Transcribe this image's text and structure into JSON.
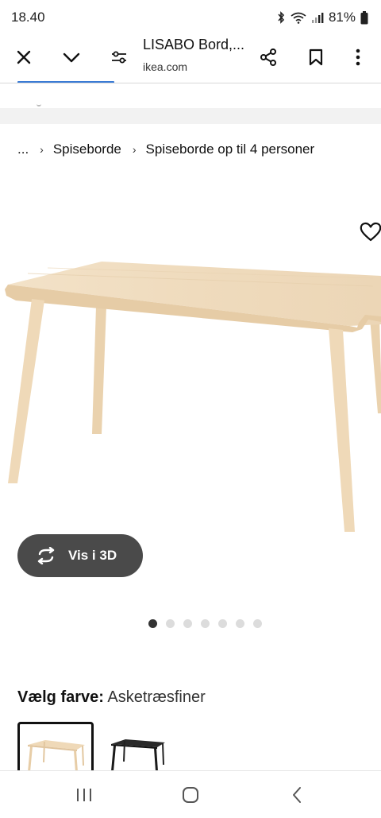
{
  "status_bar": {
    "time": "18.40",
    "battery": "81%"
  },
  "browser": {
    "title": "LISABO Bord,...",
    "domain": "ikea.com"
  },
  "breadcrumb": {
    "ellipsis": "...",
    "items": [
      "Spiseborde",
      "Spiseborde op til 4 personer"
    ]
  },
  "product": {
    "view_3d_label": "Vis i 3D",
    "carousel": {
      "count": 7,
      "active_index": 0
    },
    "color_label": "Vælg farve:",
    "color_value": "Asketræsfiner"
  },
  "colors": {
    "wood": "#f0dcc0",
    "wood_edge": "#e2c9a6",
    "button_bg": "#4a4a4a",
    "accent": "#3a7bd5"
  },
  "icons": {
    "toolbar": [
      "close-icon",
      "chevron-down-icon",
      "tune-icon",
      "share-icon",
      "bookmark-icon",
      "more-vert-icon"
    ],
    "nav": [
      "recents-icon",
      "home-icon",
      "back-icon"
    ]
  }
}
